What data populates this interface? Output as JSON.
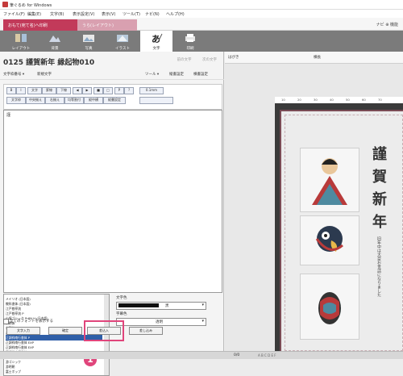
{
  "app": {
    "title": "筆ぐるめ for Windows"
  },
  "menu": [
    "ファイル(F)",
    "編集(E)",
    "文字(B)",
    "表示設定(V)",
    "表示(V)",
    "ツール(T)",
    "ナビ(N)",
    "ヘルプ(H)"
  ],
  "tabs": {
    "first": "おもて(宛て名)へ印刷",
    "second": "うら(レイアウト)",
    "navi": "ナビ ⊕ 機能"
  },
  "toolbar": [
    {
      "label": "レイアウト",
      "icon": "layout-icon"
    },
    {
      "label": "背景",
      "icon": "mountain-icon"
    },
    {
      "label": "写真",
      "icon": "photo-icon"
    },
    {
      "label": "イラスト",
      "icon": "illustration-icon"
    },
    {
      "label": "文字",
      "icon": "text-icon"
    },
    {
      "label": "印刷",
      "icon": "printer-icon"
    }
  ],
  "panel": {
    "title": "0125 謹賀新年 縁起物010",
    "prev": "前の文字",
    "next": "次の文字",
    "sub_left": "文字枠番号 ▾",
    "sub_left2": "新規文字",
    "sub_tool": "ツール ▾",
    "sub_r1": "縦書設定",
    "sub_r2": "横書設定",
    "format_row1": [
      "B",
      "I",
      "文字",
      "罫線",
      "下線",
      "◀",
      "▶",
      "■",
      "□",
      "P",
      "?"
    ],
    "format_row2": [
      "文字枠",
      "中央揃え",
      "右揃え",
      "均等割付",
      "縦中横",
      "縦書設定"
    ],
    "format_extra": "0.1mm",
    "textarea_line": "謹",
    "fonts": [
      "メイリオ (日本語)",
      "教科書体 (日本語)",
      "江戸勘亭流",
      "江戸勘亭流 P",
      "小塚ゴシック Pr6N H (日本語)",
      "宋朝体",
      "宋朝体 P",
      "正調祥南行書体",
      "正調祥南行書体 P",
      "正調祥南行書体 EXP",
      "正調祥南行書体 EXP",
      "正調祥南行書体",
      "正調祥南行書体 P",
      "游ゴシック",
      "游明朝",
      "富士ポップ"
    ],
    "selected_font_index": 8,
    "color_label": "文字色",
    "color_value": "黒",
    "size_label": "字幕色",
    "size_value": "透明",
    "checkbox_label": "全てのフォントを表示する",
    "buttons": [
      "文字入力",
      "確定",
      "差込入",
      "差し込み"
    ],
    "marker": "1"
  },
  "right": {
    "head_left": "はがき",
    "head_mid": "横長",
    "ruler": [
      "10",
      "20",
      "30",
      "40",
      "50",
      "60",
      "70"
    ],
    "kanji": [
      "謹",
      "賀",
      "新",
      "年"
    ],
    "vertical_text": "旧年中は大変お世話になりました"
  },
  "bottom": {
    "left": "0/0",
    "mid": "A B C D E F"
  },
  "colors": {
    "accent": "#c23a5a",
    "highlight": "#e0457b",
    "selected": "#2f5fa8"
  }
}
